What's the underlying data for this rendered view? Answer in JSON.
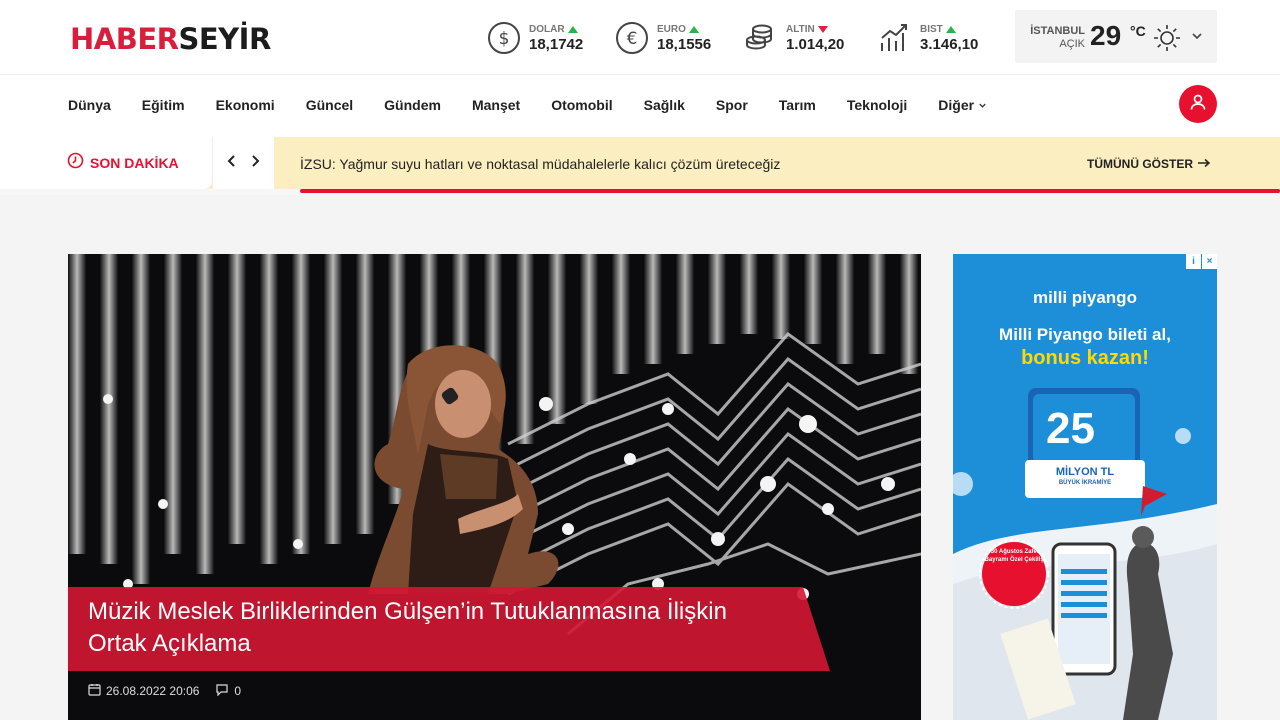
{
  "logo": {
    "part1": "HABER",
    "part2": "SEYİR"
  },
  "markets": [
    {
      "name": "DOLAR",
      "value": "18,1742",
      "trend": "up",
      "icon": "dollar-icon"
    },
    {
      "name": "EURO",
      "value": "18,1556",
      "trend": "up",
      "icon": "euro-icon"
    },
    {
      "name": "ALTIN",
      "value": "1.014,20",
      "trend": "down",
      "icon": "gold-coins-icon"
    },
    {
      "name": "BIST",
      "value": "3.146,10",
      "trend": "up",
      "icon": "chart-up-icon"
    }
  ],
  "weather": {
    "city": "İSTANBUL",
    "condition": "AÇIK",
    "temp": "29",
    "unit": "°C",
    "icon": "sun-icon"
  },
  "nav": {
    "items": [
      "Dünya",
      "Eğitim",
      "Ekonomi",
      "Güncel",
      "Gündem",
      "Manşet",
      "Otomobil",
      "Sağlık",
      "Spor",
      "Tarım",
      "Teknoloji",
      "Diğer"
    ]
  },
  "breaking": {
    "label": "SON DAKİKA",
    "headline": "İZSU: Yağmur suyu hatları ve noktasal müdahalelerle kalıcı çözüm üreteceğiz",
    "show_all": "TÜMÜNÜ GÖSTER"
  },
  "hero": {
    "title": "Müzik Meslek Birliklerinden Gülşen’in Tutuklanmasına İlişkin Ortak Açıklama",
    "date": "26.08.2022 20:06",
    "comments": "0"
  },
  "ad": {
    "brand": "milli piyango",
    "line1": "Milli Piyango bileti al,",
    "line2": "bonus kazan!",
    "amount": "25",
    "amount_unit": "MİLYON TL",
    "amount_sub": "BÜYÜK İKRAMİYE",
    "badge": "30 Ağustos Zafer Bayramı Özel Çekilişi"
  },
  "colors": {
    "brand_red": "#e8102f",
    "ticker_bg": "#fbeec0",
    "ad_blue": "#1d8fd8"
  }
}
